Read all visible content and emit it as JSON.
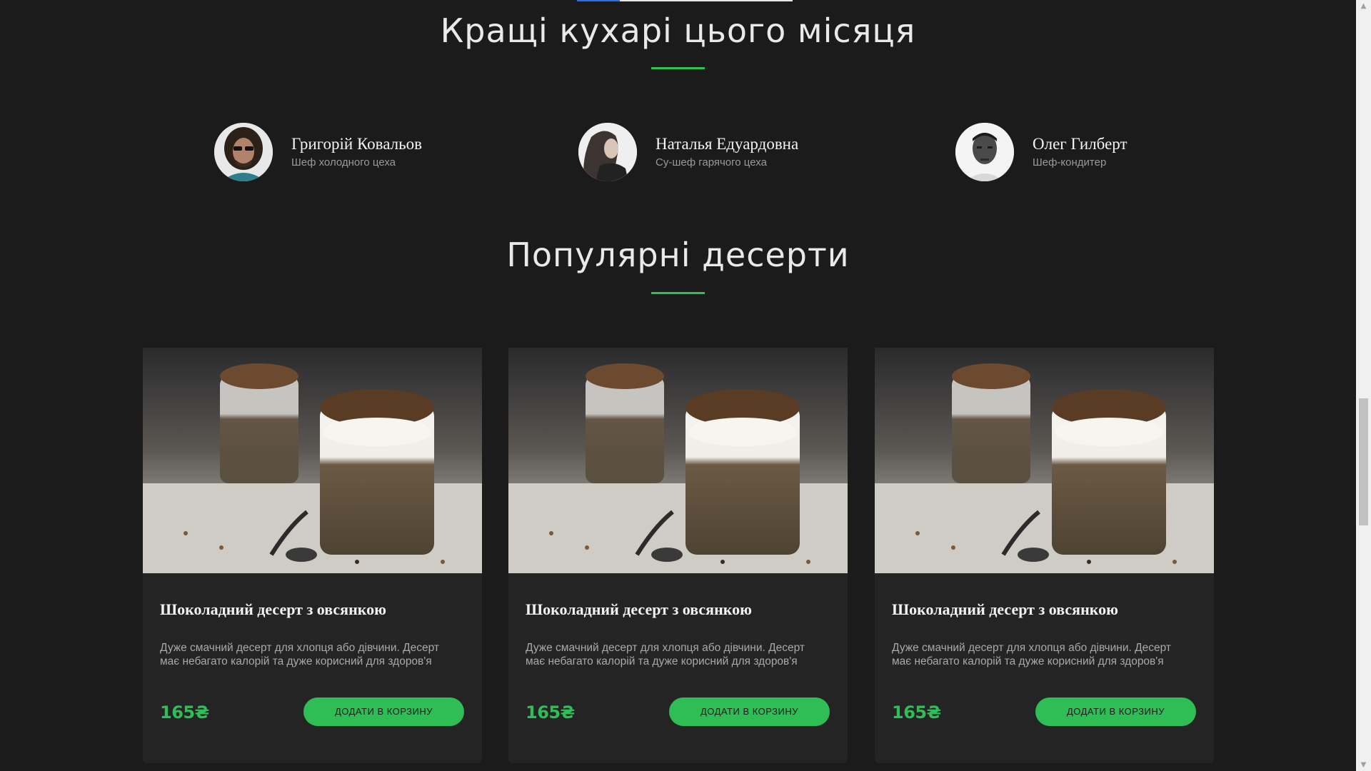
{
  "chefs_section": {
    "title": "Кращі кухарі цього місяця"
  },
  "chefs": [
    {
      "name": "Григорій Ковальов",
      "role": "Шеф холодного цеха",
      "avatar_icon": "chef-avatar-photo"
    },
    {
      "name": "Наталья Едуардовна",
      "role": "Су-шеф гарячого цеха",
      "avatar_icon": "chef-avatar-photo"
    },
    {
      "name": "Олег Гилберт",
      "role": "Шеф-кондитер",
      "avatar_icon": "chef-avatar-photo"
    }
  ],
  "desserts_section": {
    "title": "Популярні десерти"
  },
  "desserts": [
    {
      "title": "Шоколадний десерт з овсянкою",
      "description": "Дуже смачний десерт для хлопця або дівчини. Десерт має небагато калорій та дуже корисний для здоров'я",
      "price": "165₴",
      "button_label": "ДОДАТИ В КОРЗИНУ"
    },
    {
      "title": "Шоколадний десерт з овсянкою",
      "description": "Дуже смачний десерт для хлопця або дівчини. Десерт має небагато калорій та дуже корисний для здоров'я",
      "price": "165₴",
      "button_label": "ДОДАТИ В КОРЗИНУ"
    },
    {
      "title": "Шоколадний десерт з овсянкою",
      "description": "Дуже смачний десерт для хлопця або дівчини. Десерт має небагато калорій та дуже корисний для здоров'я",
      "price": "165₴",
      "button_label": "ДОДАТИ В КОРЗИНУ"
    }
  ],
  "colors": {
    "background": "#1b1b1b",
    "card_background": "#242424",
    "accent_green": "#2fbd55",
    "title_text": "#e9e9e9",
    "muted_text": "#9a9a9a"
  },
  "scrollbar": {
    "up_icon": "scroll-up-arrow-icon",
    "down_icon": "scroll-down-arrow-icon"
  }
}
